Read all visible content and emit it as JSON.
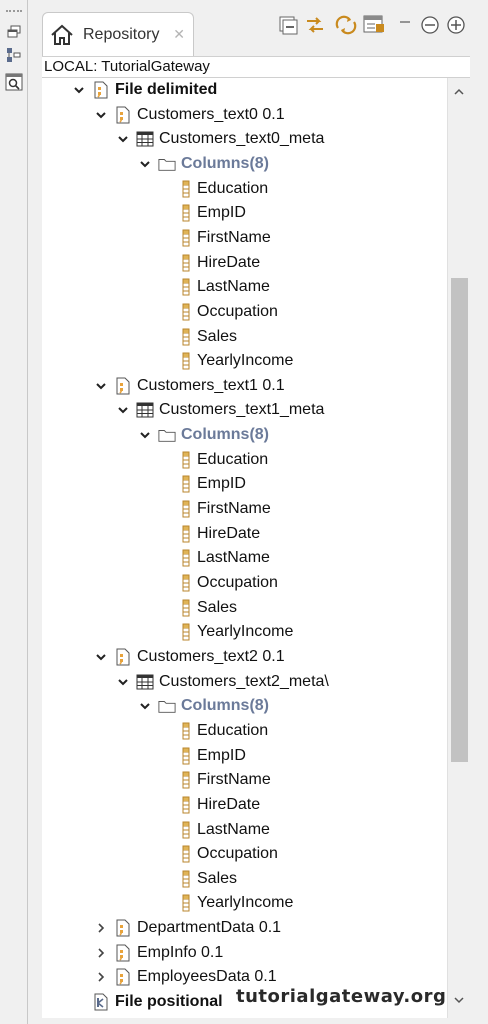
{
  "view": {
    "tab_title": "Repository",
    "location": "LOCAL: TutorialGateway"
  },
  "tree": [
    {
      "depth": 0,
      "twisty": "expanded",
      "icon": "file-delimited-icon",
      "label": "File delimited",
      "style": "bold"
    },
    {
      "depth": 1,
      "twisty": "expanded",
      "icon": "file-delimited-icon",
      "label": "Customers_text0 0.1"
    },
    {
      "depth": 2,
      "twisty": "expanded",
      "icon": "table-icon",
      "label": "Customers_text0_meta"
    },
    {
      "depth": 3,
      "twisty": "expanded",
      "icon": "folder-icon",
      "label": "Columns(8)",
      "style": "cols"
    },
    {
      "depth": 4,
      "icon": "column-icon",
      "label": "Education"
    },
    {
      "depth": 4,
      "icon": "column-icon",
      "label": "EmpID"
    },
    {
      "depth": 4,
      "icon": "column-icon",
      "label": "FirstName"
    },
    {
      "depth": 4,
      "icon": "column-icon",
      "label": "HireDate"
    },
    {
      "depth": 4,
      "icon": "column-icon",
      "label": "LastName"
    },
    {
      "depth": 4,
      "icon": "column-icon",
      "label": "Occupation"
    },
    {
      "depth": 4,
      "icon": "column-icon",
      "label": "Sales"
    },
    {
      "depth": 4,
      "icon": "column-icon",
      "label": "YearlyIncome"
    },
    {
      "depth": 1,
      "twisty": "expanded",
      "icon": "file-delimited-icon",
      "label": "Customers_text1 0.1"
    },
    {
      "depth": 2,
      "twisty": "expanded",
      "icon": "table-icon",
      "label": "Customers_text1_meta"
    },
    {
      "depth": 3,
      "twisty": "expanded",
      "icon": "folder-icon",
      "label": "Columns(8)",
      "style": "cols"
    },
    {
      "depth": 4,
      "icon": "column-icon",
      "label": "Education"
    },
    {
      "depth": 4,
      "icon": "column-icon",
      "label": "EmpID"
    },
    {
      "depth": 4,
      "icon": "column-icon",
      "label": "FirstName"
    },
    {
      "depth": 4,
      "icon": "column-icon",
      "label": "HireDate"
    },
    {
      "depth": 4,
      "icon": "column-icon",
      "label": "LastName"
    },
    {
      "depth": 4,
      "icon": "column-icon",
      "label": "Occupation"
    },
    {
      "depth": 4,
      "icon": "column-icon",
      "label": "Sales"
    },
    {
      "depth": 4,
      "icon": "column-icon",
      "label": "YearlyIncome"
    },
    {
      "depth": 1,
      "twisty": "expanded",
      "icon": "file-delimited-icon",
      "label": "Customers_text2 0.1"
    },
    {
      "depth": 2,
      "twisty": "expanded",
      "icon": "table-icon",
      "label": "Customers_text2_meta\\"
    },
    {
      "depth": 3,
      "twisty": "expanded",
      "icon": "folder-icon",
      "label": "Columns(8)",
      "style": "cols"
    },
    {
      "depth": 4,
      "icon": "column-icon",
      "label": "Education"
    },
    {
      "depth": 4,
      "icon": "column-icon",
      "label": "EmpID"
    },
    {
      "depth": 4,
      "icon": "column-icon",
      "label": "FirstName"
    },
    {
      "depth": 4,
      "icon": "column-icon",
      "label": "HireDate"
    },
    {
      "depth": 4,
      "icon": "column-icon",
      "label": "LastName"
    },
    {
      "depth": 4,
      "icon": "column-icon",
      "label": "Occupation"
    },
    {
      "depth": 4,
      "icon": "column-icon",
      "label": "Sales"
    },
    {
      "depth": 4,
      "icon": "column-icon",
      "label": "YearlyIncome"
    },
    {
      "depth": 1,
      "twisty": "collapsed",
      "icon": "file-delimited-icon",
      "label": "DepartmentData 0.1"
    },
    {
      "depth": 1,
      "twisty": "collapsed",
      "icon": "file-delimited-icon",
      "label": "EmpInfo 0.1"
    },
    {
      "depth": 1,
      "twisty": "collapsed",
      "icon": "file-delimited-icon",
      "label": "EmployeesData 0.1"
    },
    {
      "depth": 0,
      "twisty": "none",
      "icon": "file-positional-icon",
      "label": "File positional",
      "style": "bold"
    }
  ],
  "watermark": "tutorialgateway.org",
  "colors": {
    "accent_orange": "#e8a33c",
    "column_yellow": "#d9a441",
    "columns_label": "#6b7a99",
    "scroll_thumb": "#c2c2c2"
  }
}
